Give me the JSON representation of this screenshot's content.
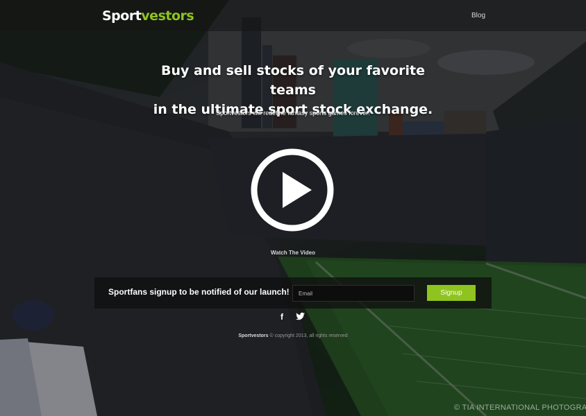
{
  "header": {
    "logo_part1": "Sport",
    "logo_part2": "vestors",
    "nav_blog": "Blog"
  },
  "hero": {
    "headline_line1": "Buy and sell stocks of your favorite teams",
    "headline_line2": "in the ultimate sport stock exchange.",
    "tagline": "Sportvestors will redefine fantasy sports games forever!",
    "watch_label": "Watch The Video",
    "play_icon": "play-circle-icon"
  },
  "signup": {
    "prompt": "Sportfans signup to be notified of our launch!",
    "email_placeholder": "Email",
    "button_label": "Signup"
  },
  "social": {
    "facebook_icon": "facebook-icon",
    "facebook_glyph": "f",
    "twitter_icon": "twitter-icon"
  },
  "footer": {
    "brand": "Sportvestors",
    "copyright_rest": "© copyright 2013, all rights reserved",
    "photo_credit": "© TIA INTERNATIONAL PHOTOGRAPHY"
  },
  "colors": {
    "accent": "#8fc31f",
    "topbar": "#141414",
    "signup_bar": "#0f0f0f"
  }
}
